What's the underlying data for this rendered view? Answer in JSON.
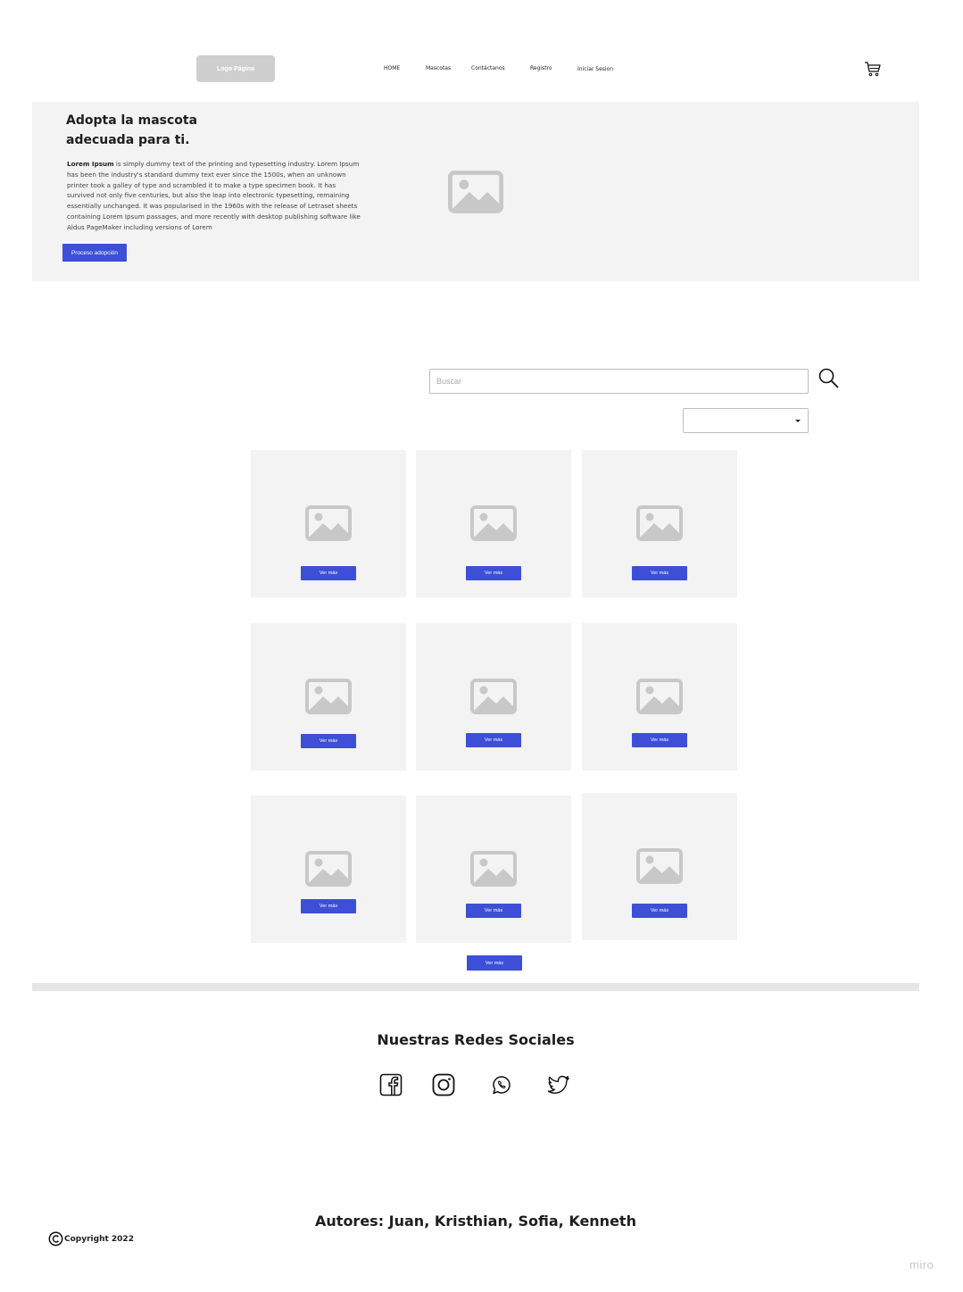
{
  "header": {
    "logo": "Logo Página",
    "nav": [
      "HOME",
      "Mascotas",
      "Contáctanos",
      "Registro",
      "Iniciar Sesion"
    ],
    "cart_icon": "shopping-cart-icon"
  },
  "hero": {
    "title_line1": "Adopta la mascota",
    "title_line2": "adecuada para ti.",
    "text_bold": "Lorem Ipsum",
    "text_rest": " is simply dummy text of the printing and typesetting industry. Lorem Ipsum has been the industry's standard dummy text ever since the 1500s, when an unknown printer took a galley of type and scrambled it to make a type specimen book. It has survived not only five centuries, but also the leap into electronic typesetting, remaining essentially unchanged. It was popularised in the 1960s with the release of Letraset sheets containing Lorem Ipsum passages, and more recently with desktop publishing software like Aldus PageMaker including versions of Lorem",
    "button": "Proceso adopción",
    "image_icon": "image-placeholder-icon"
  },
  "search": {
    "placeholder": "Buscar",
    "icon": "search-icon"
  },
  "filter": {
    "selected": ""
  },
  "cards": [
    {
      "button": "Ver más"
    },
    {
      "button": "Ver más"
    },
    {
      "button": "Ver más"
    },
    {
      "button": "Ver más"
    },
    {
      "button": "Ver más"
    },
    {
      "button": "Ver más"
    },
    {
      "button": "Ver más"
    },
    {
      "button": "Ver más"
    },
    {
      "button": "Ver más"
    }
  ],
  "more_button": "Ver más",
  "footer": {
    "social_title": "Nuestras Redes Sociales",
    "social_icons": [
      "facebook-icon",
      "instagram-icon",
      "whatsapp-icon",
      "twitter-icon"
    ],
    "authors": "Autores: Juan, Kristhian, Sofia, Kenneth",
    "copyright": "Copyright 2022"
  },
  "watermark": "miro",
  "colors": {
    "accent": "#3d4fd6",
    "panel": "#f3f3f3",
    "placeholder": "#c8c8c8"
  }
}
